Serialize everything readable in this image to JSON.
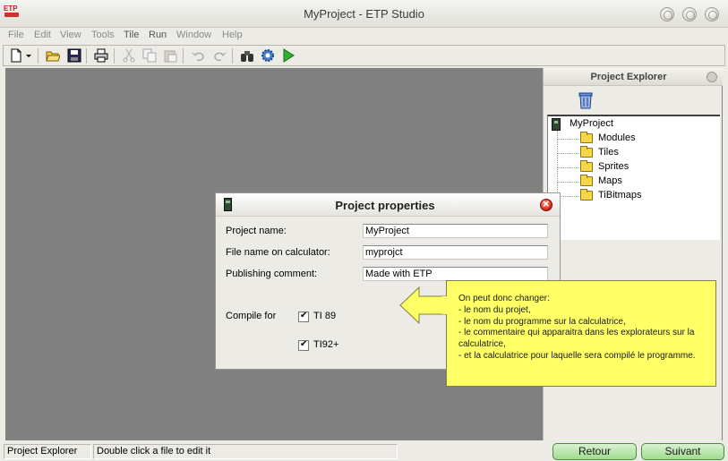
{
  "window": {
    "title": "MyProject - ETP Studio",
    "logo_text": "ETP"
  },
  "menu": [
    "File",
    "Edit",
    "View",
    "Tools",
    "Tile",
    "Run",
    "Window",
    "Help"
  ],
  "toolbar_icons": [
    "new-file-icon",
    "dropdown-arrow-icon",
    "open-folder-icon",
    "save-icon",
    "print-icon",
    "cut-icon",
    "copy-icon",
    "paste-icon",
    "undo-icon",
    "redo-icon",
    "binoculars-icon",
    "build-gear-icon",
    "run-play-icon"
  ],
  "explorer": {
    "title": "Project Explorer",
    "root": "MyProject",
    "folders": [
      "Modules",
      "Tiles",
      "Sprites",
      "Maps",
      "TiBitmaps"
    ]
  },
  "dialog": {
    "title": "Project properties",
    "fields": [
      {
        "label": "Project name:",
        "value": "MyProject"
      },
      {
        "label": "File name on calculator:",
        "value": "myprojct"
      },
      {
        "label": "Publishing comment:",
        "value": "Made with ETP"
      }
    ],
    "compile_for_label": "Compile for",
    "targets": [
      {
        "label": "TI 89",
        "checked": true
      },
      {
        "label": "TI92+",
        "checked": true
      }
    ]
  },
  "callout": {
    "text": "On peut donc changer:\n- le nom du projet,\n- le nom du programme sur la calculatrice,\n- le commentaire qui apparaitra dans les explorateurs sur la calculatrice,\n- et la calculatrice pour laquelle sera compilé le programme."
  },
  "status": {
    "panel": "Project Explorer",
    "hint": "Double click a file to edit it"
  },
  "nav": {
    "back": "Retour",
    "next": "Suivant"
  },
  "colors": {
    "workspace": "#808080",
    "callout": "#ffff66",
    "nav_button": "#b4e6a8",
    "close_red": "#d8281c"
  }
}
